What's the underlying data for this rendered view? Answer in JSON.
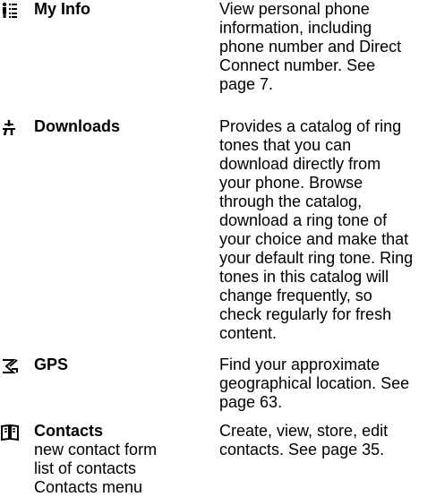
{
  "entries": [
    {
      "icon": "my-info-icon",
      "name": "My Info",
      "sub_items": [],
      "description": "View personal phone\ninformation, including\nphone number and Direct\nConnect number. See\npage 7."
    },
    {
      "icon": "downloads-icon",
      "name": "Downloads",
      "sub_items": [],
      "description": "Provides a catalog of ring\ntones that you can\ndownload directly from\nyour phone. Browse\nthrough the catalog,\ndownload a ring tone of\nyour choice and make that\nyour default ring tone. Ring\ntones in this catalog will\nchange frequently, so\ncheck regularly for fresh\ncontent."
    },
    {
      "icon": "gps-icon",
      "name": "GPS",
      "sub_items": [],
      "description": "Find your approximate\ngeographical location. See\npage 63."
    },
    {
      "icon": "contacts-book-icon",
      "name": "Contacts",
      "sub_items": [
        "new contact form",
        "list of contacts",
        "Contacts menu"
      ],
      "description": "Create, view, store, edit\ncontacts. See page 35."
    }
  ]
}
